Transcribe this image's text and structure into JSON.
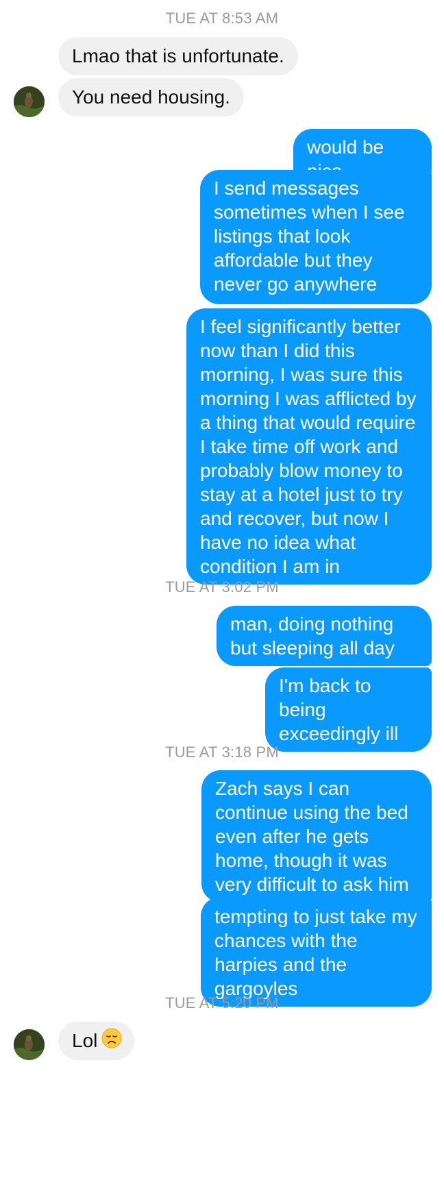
{
  "timestamps": [
    "TUE AT 8:53 AM",
    "TUE AT 3:02 PM",
    "TUE AT 3:18 PM",
    "TUE AT 5:20 PM"
  ],
  "messages": {
    "m1": "Lmao that is unfortunate.",
    "m2": "You need housing.",
    "m3": "would be nice",
    "m4": "I send messages sometimes when I see listings that look affordable but they never go anywhere",
    "m5": "I feel significantly better now than I did this morning, I was sure this morning I was afflicted by a thing that would require I take time off work and probably blow money to stay at a hotel just to try and recover, but now I have no idea what condition I am in",
    "m6": "man, doing nothing but sleeping all day",
    "m7": "I'm back to being exceedingly ill",
    "m8": "Zach says I can continue using the bed even after he gets home, though it was very difficult to ask him",
    "m9": "tempting to just take my chances with the harpies and the gargoyles",
    "m10": "Lol"
  },
  "icons": {
    "avatar": "contact-avatar",
    "emoji": "disappointed-face-emoji"
  },
  "colors": {
    "outgoing_bubble": "#0a99ff",
    "incoming_bubble": "#f0f0f0",
    "timestamp_text": "#9a9a9a"
  }
}
